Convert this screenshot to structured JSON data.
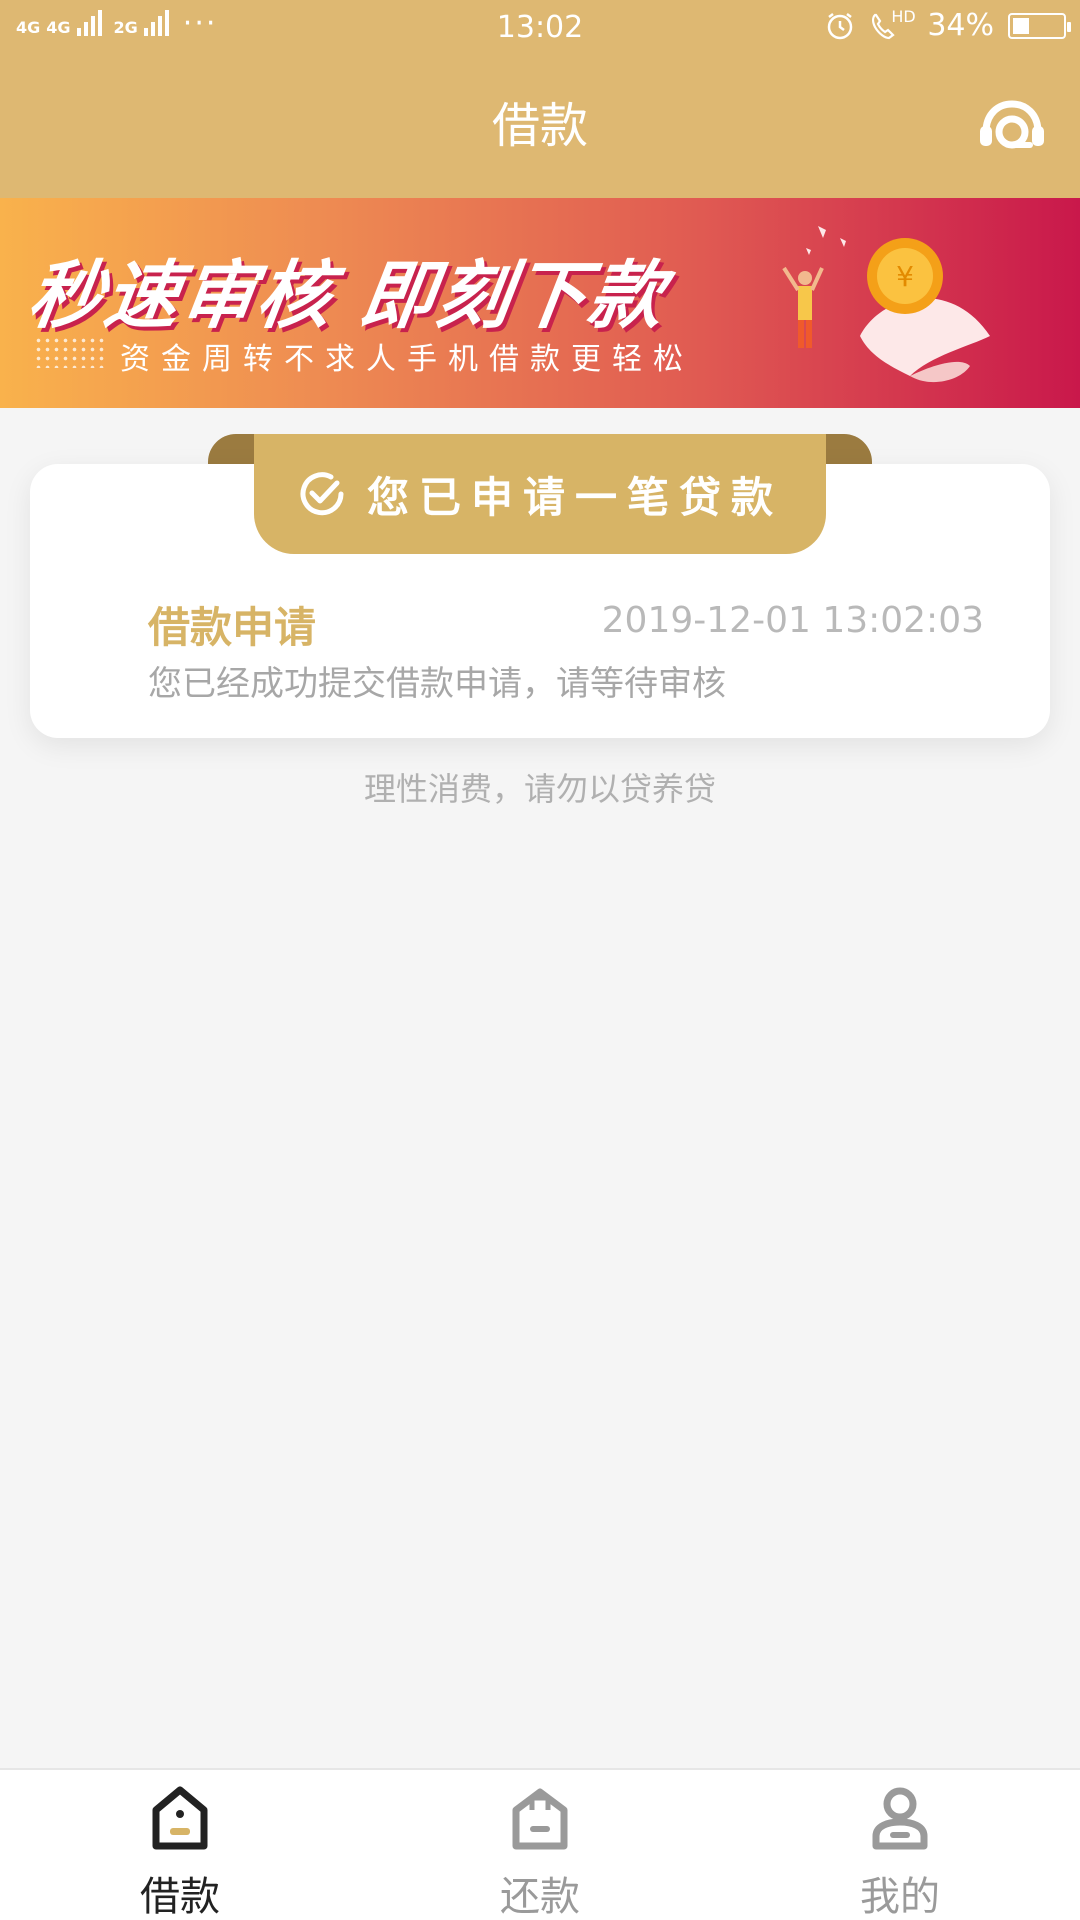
{
  "status_bar": {
    "network_1": "4G",
    "network_2": "4G",
    "network_3": "2G",
    "more": "···",
    "time": "13:02",
    "call_badge": "HD",
    "battery_percent": "34%",
    "battery_level": 0.34,
    "icons": [
      "alarm-icon",
      "wifi-call-icon",
      "battery-icon"
    ]
  },
  "header": {
    "title": "借款",
    "service_icon": "headset-icon",
    "color": "#deb872"
  },
  "banner": {
    "headline": "秒速审核 即刻下款",
    "subtitle": "资金周转不求人手机借款更轻松",
    "coin_symbol": "¥"
  },
  "card": {
    "ribbon_label": "您已申请一笔贷款",
    "title": "借款申请",
    "timestamp": "2019-12-01 13:02:03",
    "description": "您已经成功提交借款申请，请等待审核",
    "accent": "#d7b466"
  },
  "tip": "理性消费，请勿以贷养贷",
  "tabs": [
    {
      "label": "借款",
      "icon": "loan-house-icon",
      "active": true
    },
    {
      "label": "还款",
      "icon": "repay-bag-icon",
      "active": false
    },
    {
      "label": "我的",
      "icon": "user-icon",
      "active": false
    }
  ]
}
